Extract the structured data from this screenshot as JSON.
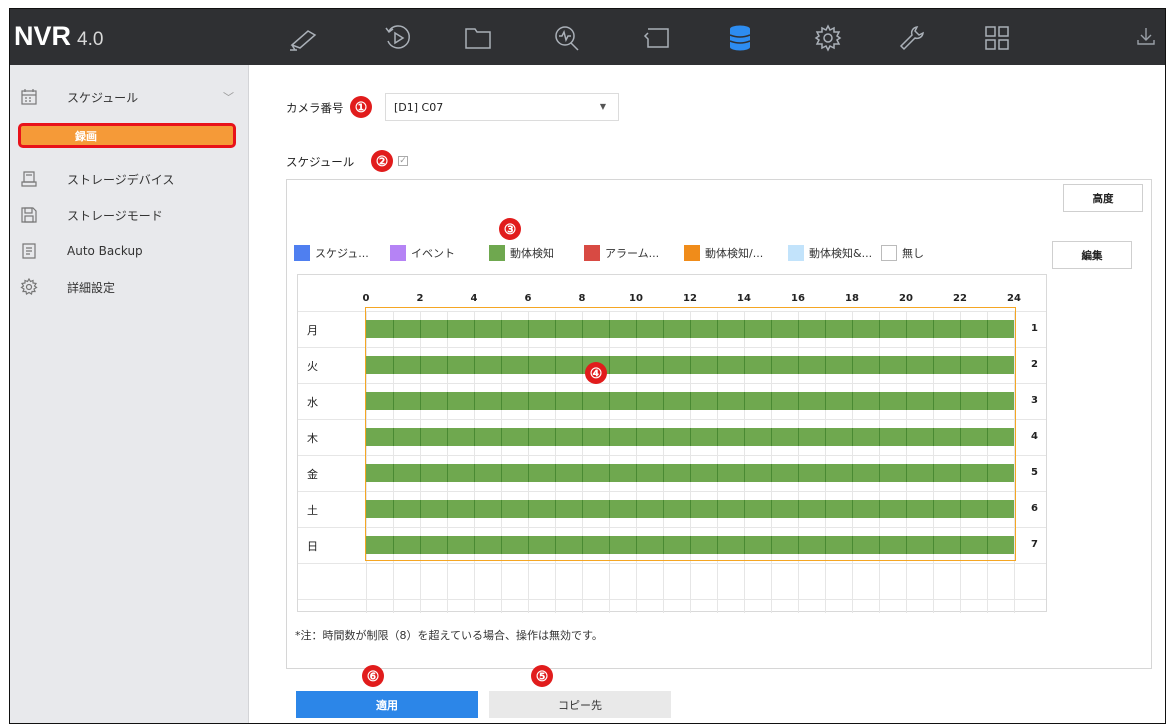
{
  "brand": {
    "name": "NVR",
    "version": "4.0"
  },
  "nav": {
    "icons": [
      "camera-icon",
      "playback-icon",
      "folder-icon",
      "search-analytics-icon",
      "monitor-icon",
      "storage-icon",
      "gear-icon",
      "wrench-icon",
      "grid-icon"
    ],
    "active": "storage-icon",
    "download": "download-icon"
  },
  "sidebar": {
    "items": [
      {
        "label": "スケジュール",
        "icon": "calendar-icon",
        "expanded": true
      },
      {
        "label": "録画",
        "sub": true,
        "selected": true
      },
      {
        "label": "ストレージデバイス",
        "icon": "hdd-icon"
      },
      {
        "label": "ストレージモード",
        "icon": "save-icon"
      },
      {
        "label": "Auto Backup",
        "icon": "document-icon"
      },
      {
        "label": "詳細設定",
        "icon": "settings-icon"
      }
    ]
  },
  "form": {
    "camera_label": "カメラ番号",
    "camera_value": "[D1] C07",
    "schedule_label": "スケジュール",
    "schedule_enabled": true
  },
  "buttons": {
    "advanced": "高度",
    "edit": "編集",
    "apply": "適用",
    "copy": "コピー先"
  },
  "legend": [
    {
      "label": "スケジュ...",
      "color": "#4f7ff0"
    },
    {
      "label": "イベント",
      "color": "#b583f5"
    },
    {
      "label": "動体検知",
      "color": "#6fa84f"
    },
    {
      "label": "アラーム...",
      "color": "#d84a43"
    },
    {
      "label": "動体検知/...",
      "color": "#f08c1a"
    },
    {
      "label": "動体検知&...",
      "color": "#c2e3fb"
    },
    {
      "label": "無し",
      "color": "#ffffff"
    }
  ],
  "schedule": {
    "hour_labels": [
      "0",
      "2",
      "4",
      "6",
      "8",
      "10",
      "12",
      "14",
      "16",
      "18",
      "20",
      "22",
      "24"
    ],
    "days": [
      "月",
      "火",
      "水",
      "木",
      "金",
      "土",
      "日"
    ],
    "row_numbers": [
      "1",
      "2",
      "3",
      "4",
      "5",
      "6",
      "7"
    ],
    "bars": [
      {
        "day": "月",
        "start": 0,
        "end": 24,
        "type": "動体検知"
      },
      {
        "day": "火",
        "start": 0,
        "end": 24,
        "type": "動体検知"
      },
      {
        "day": "水",
        "start": 0,
        "end": 24,
        "type": "動体検知"
      },
      {
        "day": "木",
        "start": 0,
        "end": 24,
        "type": "動体検知"
      },
      {
        "day": "金",
        "start": 0,
        "end": 24,
        "type": "動体検知"
      },
      {
        "day": "土",
        "start": 0,
        "end": 24,
        "type": "動体検知"
      },
      {
        "day": "日",
        "start": 0,
        "end": 24,
        "type": "動体検知"
      }
    ]
  },
  "note": "*注：時間数が制限（8）を超えている場合、操作は無効です。",
  "annotations": [
    "①",
    "②",
    "③",
    "④",
    "⑤",
    "⑥"
  ]
}
